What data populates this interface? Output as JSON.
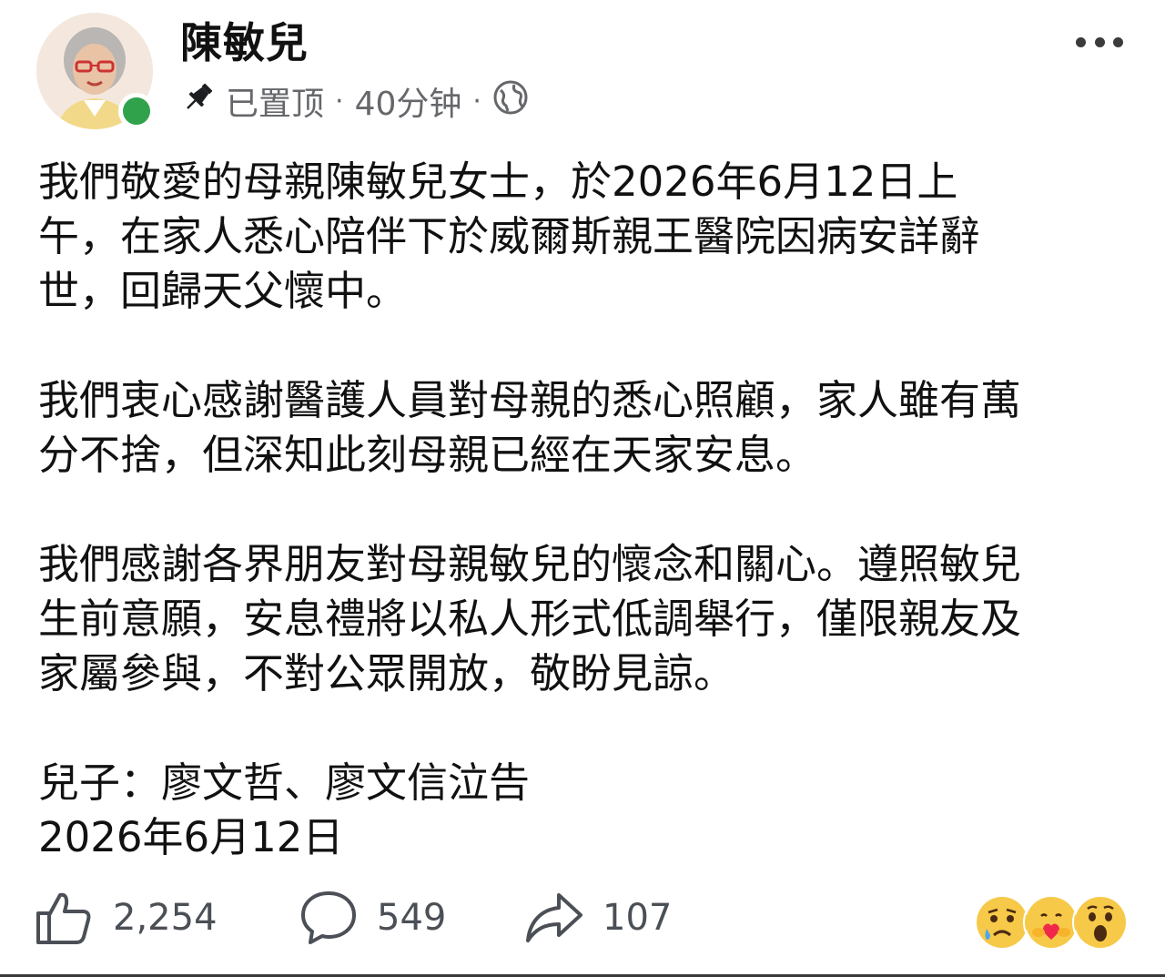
{
  "author": {
    "name": "陳敏兒",
    "online_color": "#31a24c"
  },
  "meta": {
    "pinned_icon": "pin-icon",
    "pinned_label": "已置顶",
    "time": "40分钟",
    "separator": "·",
    "audience_icon": "globe-icon"
  },
  "more_icon": "more-horizontal-icon",
  "post": {
    "paragraphs": [
      "我們敬愛的母親陳敏兒女士，於2026年6月12日上\n午，在家人悉心陪伴下於威爾斯親王醫院因病安詳辭\n世，回歸天父懷中。",
      "我們衷心感謝醫護人員對母親的悉心照顧，家人雖有萬\n分不捨，但深知此刻母親已經在天家安息。",
      "我們感謝各界朋友對母親敏兒的懷念和關心。遵照敏兒\n生前意願，安息禮將以私人形式低調舉行，僅限親友及\n家屬參與，不對公眾開放，敬盼見諒。"
    ],
    "signature_line1": "兒子：廖文哲、廖文信泣告",
    "signature_line2": "2026年6月12日"
  },
  "actions": {
    "like_icon": "thumbs-up-icon",
    "like_count": "2,254",
    "comment_icon": "comment-bubble-icon",
    "comment_count": "549",
    "share_icon": "share-arrow-icon",
    "share_count": "107"
  },
  "reactions": [
    "sad-reaction-icon",
    "care-reaction-icon",
    "wow-reaction-icon"
  ]
}
